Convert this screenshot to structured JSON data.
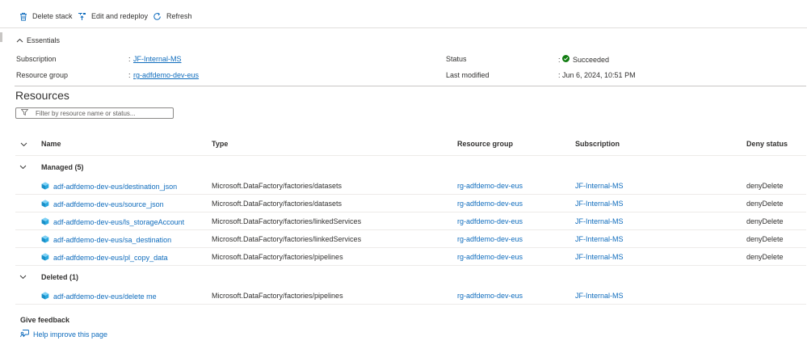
{
  "toolbar": {
    "delete_label": "Delete stack",
    "edit_label": "Edit and redeploy",
    "refresh_label": "Refresh"
  },
  "essentials": {
    "title": "Essentials",
    "subscription_label": "Subscription",
    "subscription_value": "JF-Internal-MS",
    "resource_group_label": "Resource group",
    "resource_group_value": "rg-adfdemo-dev-eus",
    "status_label": "Status",
    "status_value": "Succeeded",
    "last_modified_label": "Last modified",
    "last_modified_value": "Jun 6, 2024, 10:51 PM",
    "separator": ":"
  },
  "resources": {
    "title": "Resources",
    "filter_placeholder": "Filter by resource name or status...",
    "columns": {
      "name": "Name",
      "type": "Type",
      "resource_group": "Resource group",
      "subscription": "Subscription",
      "deny_status": "Deny status"
    },
    "groups": [
      {
        "label": "Managed (5)",
        "rows": [
          {
            "name": "adf-adfdemo-dev-eus/destination_json",
            "type": "Microsoft.DataFactory/factories/datasets",
            "rg": "rg-adfdemo-dev-eus",
            "sub": "JF-Internal-MS",
            "deny": "denyDelete"
          },
          {
            "name": "adf-adfdemo-dev-eus/source_json",
            "type": "Microsoft.DataFactory/factories/datasets",
            "rg": "rg-adfdemo-dev-eus",
            "sub": "JF-Internal-MS",
            "deny": "denyDelete"
          },
          {
            "name": "adf-adfdemo-dev-eus/ls_storageAccount",
            "type": "Microsoft.DataFactory/factories/linkedServices",
            "rg": "rg-adfdemo-dev-eus",
            "sub": "JF-Internal-MS",
            "deny": "denyDelete"
          },
          {
            "name": "adf-adfdemo-dev-eus/sa_destination",
            "type": "Microsoft.DataFactory/factories/linkedServices",
            "rg": "rg-adfdemo-dev-eus",
            "sub": "JF-Internal-MS",
            "deny": "denyDelete"
          },
          {
            "name": "adf-adfdemo-dev-eus/pl_copy_data",
            "type": "Microsoft.DataFactory/factories/pipelines",
            "rg": "rg-adfdemo-dev-eus",
            "sub": "JF-Internal-MS",
            "deny": "denyDelete"
          }
        ]
      },
      {
        "label": "Deleted (1)",
        "rows": [
          {
            "name": "adf-adfdemo-dev-eus/delete me",
            "type": "Microsoft.DataFactory/factories/pipelines",
            "rg": "rg-adfdemo-dev-eus",
            "sub": "JF-Internal-MS",
            "deny": ""
          }
        ]
      }
    ]
  },
  "feedback": {
    "title": "Give feedback",
    "link": "Help improve this page"
  },
  "colors": {
    "accent": "#0f6cbd",
    "success": "#107c10",
    "text": "#323130",
    "resource_icon": "#29a9e0"
  },
  "icons": [
    "trash-icon",
    "edit-upload-icon",
    "refresh-icon",
    "chevron-up-icon",
    "filter-icon",
    "chevron-down-icon",
    "check-circle-icon",
    "resource-cube-icon",
    "feedback-icon"
  ]
}
